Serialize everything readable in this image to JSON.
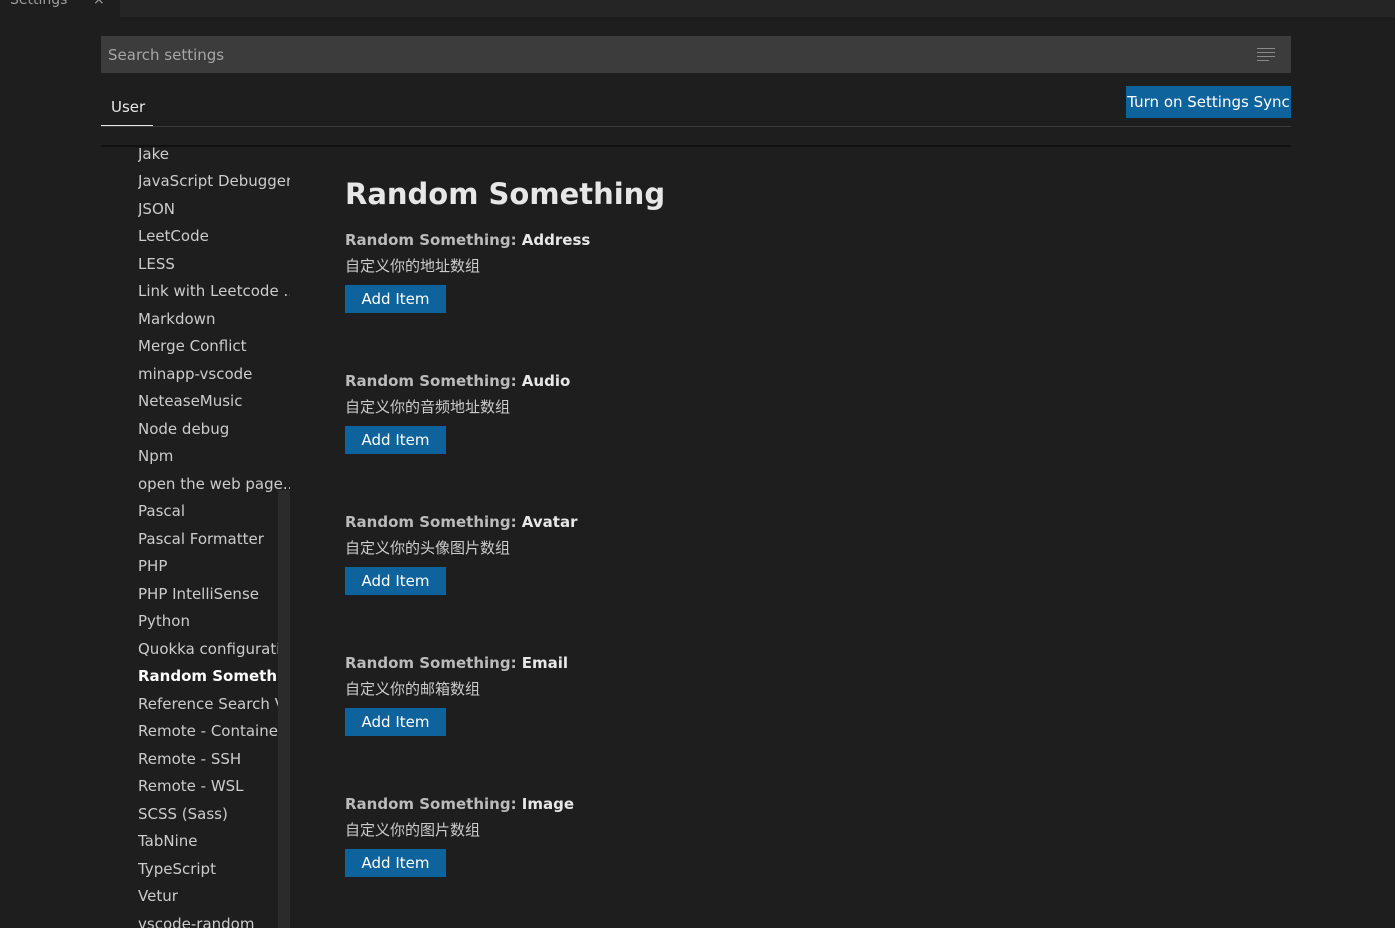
{
  "editor_tab": {
    "title": "Settings",
    "close_icon": "×"
  },
  "search": {
    "placeholder": "Search settings",
    "value": "",
    "filter_icon": "filter-icon"
  },
  "scope_tabs": [
    {
      "label": "User",
      "active": true
    }
  ],
  "sync_button": {
    "label": "Turn on Settings Sync"
  },
  "toc": {
    "items": [
      {
        "label": "Jake"
      },
      {
        "label": "JavaScript Debugger"
      },
      {
        "label": "JSON"
      },
      {
        "label": "LeetCode"
      },
      {
        "label": "LESS"
      },
      {
        "label": "Link with Leetcode ..."
      },
      {
        "label": "Markdown"
      },
      {
        "label": "Merge Conflict"
      },
      {
        "label": "minapp-vscode"
      },
      {
        "label": "NeteaseMusic"
      },
      {
        "label": "Node debug"
      },
      {
        "label": "Npm"
      },
      {
        "label": "open the web page..."
      },
      {
        "label": "Pascal"
      },
      {
        "label": "Pascal Formatter"
      },
      {
        "label": "PHP"
      },
      {
        "label": "PHP IntelliSense"
      },
      {
        "label": "Python"
      },
      {
        "label": "Quokka configurati..."
      },
      {
        "label": "Random Something",
        "active": true
      },
      {
        "label": "Reference Search V..."
      },
      {
        "label": "Remote - Containers"
      },
      {
        "label": "Remote - SSH"
      },
      {
        "label": "Remote - WSL"
      },
      {
        "label": "SCSS (Sass)"
      },
      {
        "label": "TabNine"
      },
      {
        "label": "TypeScript"
      },
      {
        "label": "Vetur"
      },
      {
        "label": "vscode-random"
      }
    ]
  },
  "main": {
    "section_title": "Random Something",
    "settings": [
      {
        "category": "Random Something: ",
        "key": "Address",
        "description": "自定义你的地址数组",
        "button_label": "Add Item"
      },
      {
        "category": "Random Something: ",
        "key": "Audio",
        "description": "自定义你的音频地址数组",
        "button_label": "Add Item"
      },
      {
        "category": "Random Something: ",
        "key": "Avatar",
        "description": "自定义你的头像图片数组",
        "button_label": "Add Item"
      },
      {
        "category": "Random Something: ",
        "key": "Email",
        "description": "自定义你的邮箱数组",
        "button_label": "Add Item"
      },
      {
        "category": "Random Something: ",
        "key": "Image",
        "description": "自定义你的图片数组",
        "button_label": "Add Item"
      }
    ]
  },
  "colors": {
    "background": "#1e1e1e",
    "input_background": "#3c3c3c",
    "button_background": "#0e639c",
    "button_foreground": "#ffffff"
  }
}
